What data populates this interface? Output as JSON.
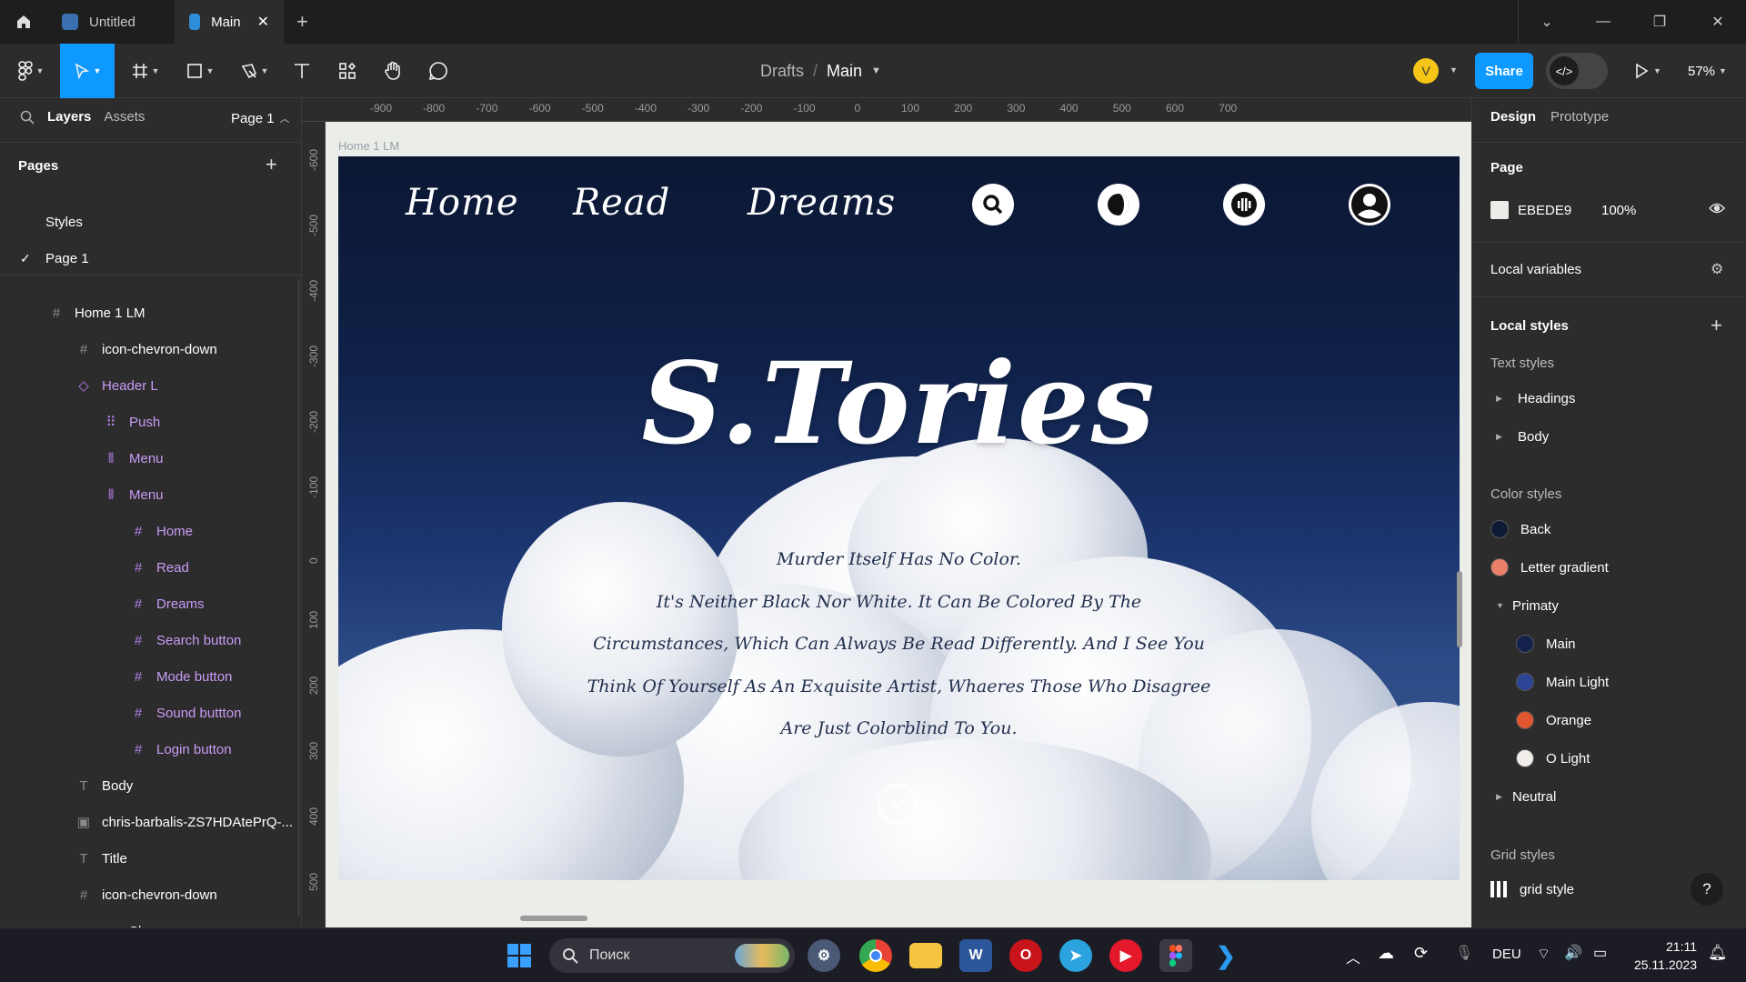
{
  "tabs": [
    {
      "label": "Untitled",
      "active": false
    },
    {
      "label": "Main",
      "active": true
    }
  ],
  "toolbar": {
    "breadcrumb_root": "Drafts",
    "breadcrumb_sep": "/",
    "breadcrumb_file": "Main",
    "avatar_initial": "V",
    "share_label": "Share",
    "zoom": "57%"
  },
  "left_panel": {
    "tab_layers": "Layers",
    "tab_assets": "Assets",
    "page_selector": "Page 1",
    "pages_heading": "Pages",
    "pages": [
      {
        "label": "Styles",
        "selected": false
      },
      {
        "label": "Page 1",
        "selected": true
      }
    ],
    "layers": [
      {
        "label": "Home 1 LM",
        "icon": "frame-icon",
        "level": 0,
        "component": false
      },
      {
        "label": "icon-chevron-down",
        "icon": "frame-icon",
        "level": 1,
        "component": false
      },
      {
        "label": "Header L",
        "icon": "instance-icon",
        "level": 1,
        "component": true
      },
      {
        "label": "Push",
        "icon": "grid-layout-icon",
        "level": 2,
        "component": true
      },
      {
        "label": "Menu",
        "icon": "autolayout-icon",
        "level": 2,
        "component": true
      },
      {
        "label": "Menu",
        "icon": "autolayout-icon",
        "level": 2,
        "component": true
      },
      {
        "label": "Home",
        "icon": "frame-icon",
        "level": 3,
        "component": true
      },
      {
        "label": "Read",
        "icon": "frame-icon",
        "level": 3,
        "component": true
      },
      {
        "label": "Dreams",
        "icon": "frame-icon",
        "level": 3,
        "component": true
      },
      {
        "label": "Search button",
        "icon": "frame-icon",
        "level": 3,
        "component": true
      },
      {
        "label": "Mode button",
        "icon": "frame-icon",
        "level": 3,
        "component": true
      },
      {
        "label": "Sound buttton",
        "icon": "frame-icon",
        "level": 3,
        "component": true
      },
      {
        "label": "Login button",
        "icon": "frame-icon",
        "level": 3,
        "component": true
      },
      {
        "label": "Body",
        "icon": "text-icon",
        "level": 1,
        "component": false
      },
      {
        "label": "chris-barbalis-ZS7HDAtePrQ-...",
        "icon": "image-icon",
        "level": 1,
        "component": false
      },
      {
        "label": "Title",
        "icon": "text-icon",
        "level": 1,
        "component": false
      },
      {
        "label": "icon-chevron-down",
        "icon": "frame-icon",
        "level": 1,
        "component": false
      },
      {
        "label": "Shape",
        "icon": "chevron-down-icon",
        "level": 2,
        "component": false
      }
    ]
  },
  "canvas": {
    "ruler_top": [
      "-900",
      "-800",
      "-700",
      "-600",
      "-500",
      "-400",
      "-300",
      "-200",
      "-100",
      "0",
      "100",
      "200",
      "300",
      "400",
      "500",
      "600",
      "700"
    ],
    "ruler_left": [
      "-600",
      "-500",
      "-400",
      "-300",
      "-200",
      "-100",
      "0",
      "100",
      "200",
      "300",
      "400",
      "500"
    ],
    "frame_label": "Home 1 LM",
    "nav": [
      "Home",
      "Read",
      "Dreams"
    ],
    "title": "S.Tories",
    "body_lines": [
      "Murder Itself Has No Color.",
      "It's Neither Black Nor White. It Can Be Colored By The",
      "Circumstances, Which Can Always Be Read Differently. And I See You",
      "Think Of Yourself As An Exquisite Artist, Whaeres Those Who Disagree",
      "Are Just Colorblind To You."
    ]
  },
  "right_panel": {
    "tab_design": "Design",
    "tab_prototype": "Prototype",
    "page_heading": "Page",
    "page_color_hex": "EBEDE9",
    "page_color": "#ebede9",
    "page_opacity": "100%",
    "local_variables": "Local variables",
    "local_styles": "Local styles",
    "text_styles_heading": "Text styles",
    "text_styles": [
      "Headings",
      "Body"
    ],
    "color_styles_heading": "Color styles",
    "color_styles": [
      {
        "label": "Back",
        "color": "#0f1a35",
        "indent": false
      },
      {
        "label": "Letter gradient",
        "color": "#e9806a",
        "indent": false
      },
      {
        "label": "Primaty",
        "color": "",
        "indent": false,
        "group": true
      },
      {
        "label": "Main",
        "color": "#14214d",
        "indent": true
      },
      {
        "label": "Main Light",
        "color": "#2b4594",
        "indent": true
      },
      {
        "label": "Orange",
        "color": "#e0562f",
        "indent": true
      },
      {
        "label": "O Light",
        "color": "#f1eeea",
        "indent": true
      },
      {
        "label": "Neutral",
        "color": "",
        "indent": false,
        "group": true,
        "collapsed": true
      }
    ],
    "grid_styles_heading": "Grid styles",
    "grid_style": "grid style",
    "help": "?"
  },
  "taskbar": {
    "search_placeholder": "Поиск",
    "language": "DEU",
    "time": "21:11",
    "date": "25.11.2023"
  }
}
